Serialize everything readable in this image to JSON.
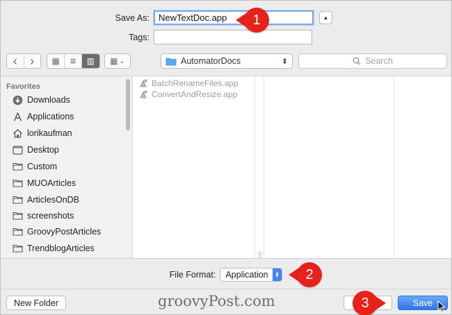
{
  "form": {
    "save_as_label": "Save As:",
    "save_as_value": "NewTextDoc.app",
    "tags_label": "Tags:",
    "tags_value": "",
    "collapse_glyph": "▲"
  },
  "toolbar": {
    "back_glyph": "‹",
    "forward_glyph": "›",
    "view_icons_glyph": "▦",
    "view_list_glyph": "≡",
    "view_columns_glyph": "▥",
    "arrange_glyph": "▦",
    "arrange_chevron": "⌄",
    "location": "AutomatorDocs",
    "location_stepper": "⬍",
    "search_placeholder": "Search"
  },
  "sidebar": {
    "heading": "Favorites",
    "items": [
      {
        "label": "Downloads",
        "icon": "downloads-icon"
      },
      {
        "label": "Applications",
        "icon": "applications-icon"
      },
      {
        "label": "lorikaufman",
        "icon": "home-icon"
      },
      {
        "label": "Desktop",
        "icon": "desktop-icon"
      },
      {
        "label": "Custom",
        "icon": "folder-icon"
      },
      {
        "label": "MUOArticles",
        "icon": "folder-icon"
      },
      {
        "label": "ArticlesOnDB",
        "icon": "folder-icon"
      },
      {
        "label": "screenshots",
        "icon": "folder-icon"
      },
      {
        "label": "GroovyPostArticles",
        "icon": "folder-icon"
      },
      {
        "label": "TrendblogArticles",
        "icon": "folder-icon"
      }
    ]
  },
  "files": [
    {
      "name": "BatchRenameFiles.app",
      "icon": "automator-app-icon"
    },
    {
      "name": "ConvertAndResize.app",
      "icon": "automator-app-icon"
    }
  ],
  "column_handle": "||",
  "format": {
    "label": "File Format:",
    "value": "Application",
    "stepper": "⬍"
  },
  "bottom": {
    "new_folder_label": "New Folder",
    "cancel_label": "",
    "save_label": "Save"
  },
  "watermark": "groovyPost.com",
  "annotations": {
    "one": "1",
    "two": "2",
    "three": "3"
  },
  "colors": {
    "accent": "#3f86f0",
    "callout": "#e8211a",
    "focus_ring": "#7aa9e6"
  }
}
